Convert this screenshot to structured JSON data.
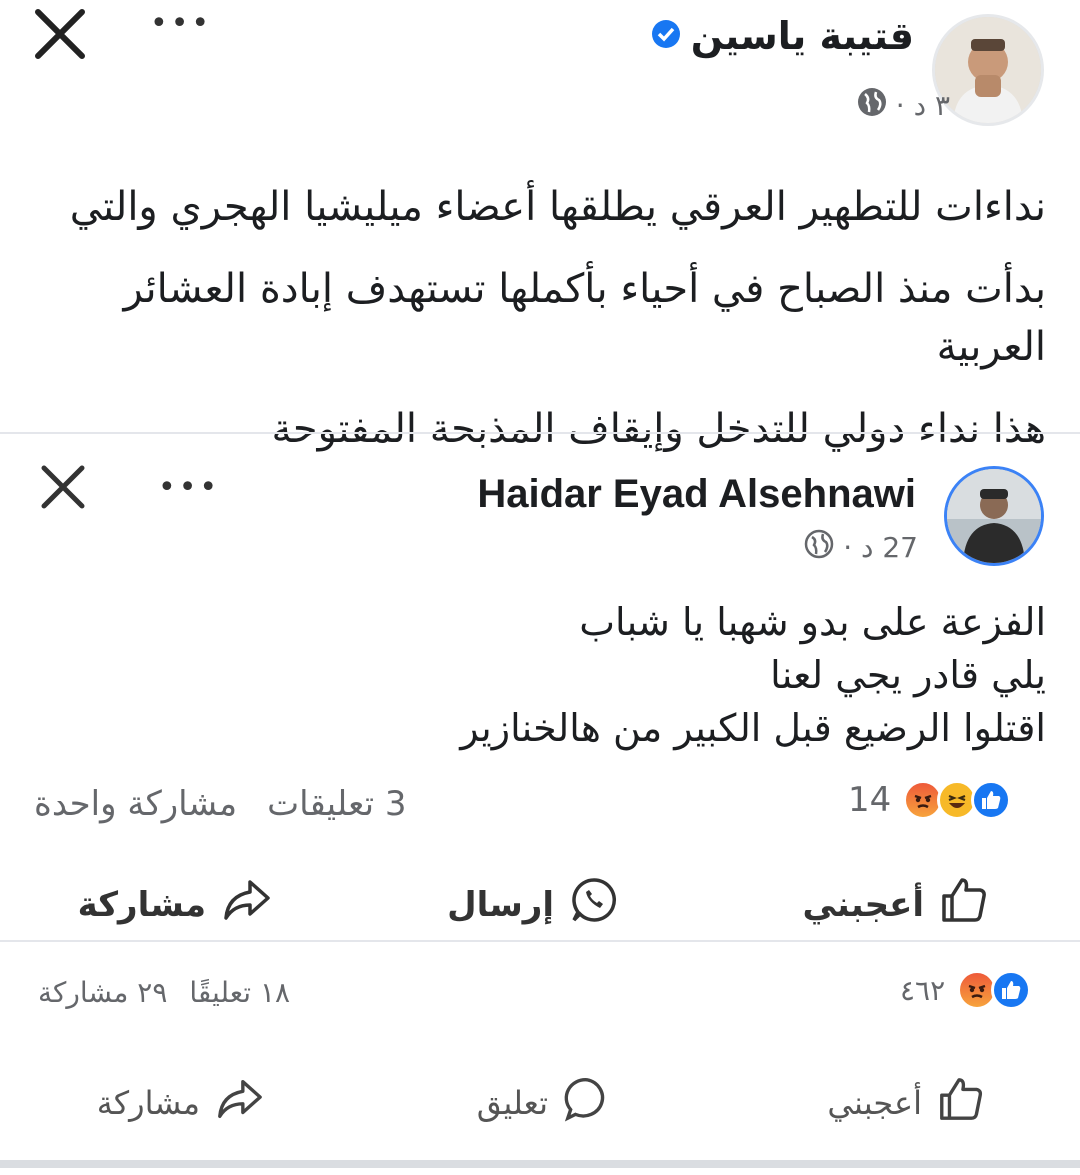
{
  "post1": {
    "author": "قتيبة ياسين",
    "time": "٣ د ·",
    "text_lines": [
      "نداءات للتطهير العرقي يطلقها أعضاء ميليشيا الهجري والتي",
      "بدأت منذ الصباح في أحياء بأكملها تستهدف إبادة العشائر العربية",
      "هذا نداء دولي للتدخل وإيقاف المذبحة المفتوحة"
    ]
  },
  "post2": {
    "author": "Haidar Eyad Alsehnawi",
    "time": "27 د ·",
    "text_lines": [
      "الفزعة على بدو شهبا يا شباب",
      "يلي قادر يجي لعنا",
      "اقتلوا الرضيع قبل الكبير من هالخنازير"
    ],
    "reaction_count": "14",
    "comments": "3 تعليقات",
    "shares": "مشاركة واحدة",
    "actions": {
      "like": "أعجبني",
      "send": "إرسال",
      "share": "مشاركة"
    }
  },
  "footer": {
    "reaction_count": "٤٦٢",
    "comments": "١٨ تعليقًا",
    "shares": "٢٩ مشاركة",
    "actions": {
      "like": "أعجبني",
      "comment": "تعليق",
      "share": "مشاركة"
    }
  }
}
